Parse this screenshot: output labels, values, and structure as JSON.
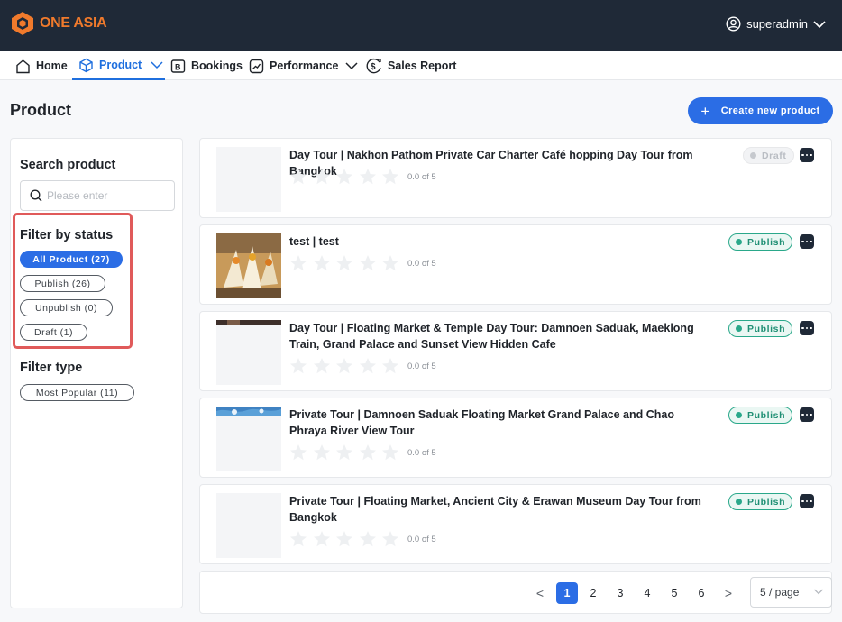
{
  "brand": {
    "name": "ONE ASIA",
    "logo_color": "#f07a2c"
  },
  "user": {
    "name": "superadmin",
    "icon": "user-circle-icon"
  },
  "nav": [
    {
      "label": "Home",
      "icon": "home-icon"
    },
    {
      "label": "Product",
      "icon": "box-icon",
      "active": true
    },
    {
      "label": "Bookings",
      "icon": "bookings-icon"
    },
    {
      "label": "Performance",
      "icon": "trend-icon"
    },
    {
      "label": "Sales Report",
      "icon": "dollar-icon"
    }
  ],
  "page": {
    "title": "Product",
    "create_label": "Create new product"
  },
  "sidebar": {
    "search_heading": "Search product",
    "search_placeholder": "Please enter",
    "status_heading": "Filter by status",
    "status_filters": [
      {
        "label": "All Product (27)",
        "active": true
      },
      {
        "label": "Publish (26)"
      },
      {
        "label": "Unpublish (0)"
      },
      {
        "label": "Draft (1)"
      }
    ],
    "type_heading": "Filter type",
    "type_filters": [
      {
        "label": "Most Popular (11)"
      }
    ]
  },
  "products": [
    {
      "title": "Day Tour | Nakhon Pathom Private Car Charter Café hopping Day Tour from Bangkok",
      "status": "Draft",
      "rating_text": "0.0 of 5",
      "rating": 0
    },
    {
      "title": "test | test",
      "status": "Publish",
      "rating_text": "0.0 of 5",
      "rating": 0
    },
    {
      "title": "Day Tour | Floating Market & Temple Day Tour: Damnoen Saduak, Maeklong Train, Grand Palace and Sunset View Hidden Cafe",
      "status": "Publish",
      "rating_text": "0.0 of 5",
      "rating": 0
    },
    {
      "title": "Private Tour | Damnoen Saduak Floating Market Grand Palace and Chao Phraya River View Tour",
      "status": "Publish",
      "rating_text": "0.0 of 5",
      "rating": 0
    },
    {
      "title": "Private Tour | Floating Market, Ancient City & Erawan Museum Day Tour from Bangkok",
      "status": "Publish",
      "rating_text": "0.0 of 5",
      "rating": 0
    }
  ],
  "pagination": {
    "prev": "<",
    "next": ">",
    "pages": [
      "1",
      "2",
      "3",
      "4",
      "5",
      "6"
    ],
    "current": "1",
    "page_size": "5 / page"
  },
  "colors": {
    "primary": "#2b6de5",
    "topbar": "#1f2937",
    "publish": "#2aa88a",
    "highlight": "#e05a5a"
  }
}
